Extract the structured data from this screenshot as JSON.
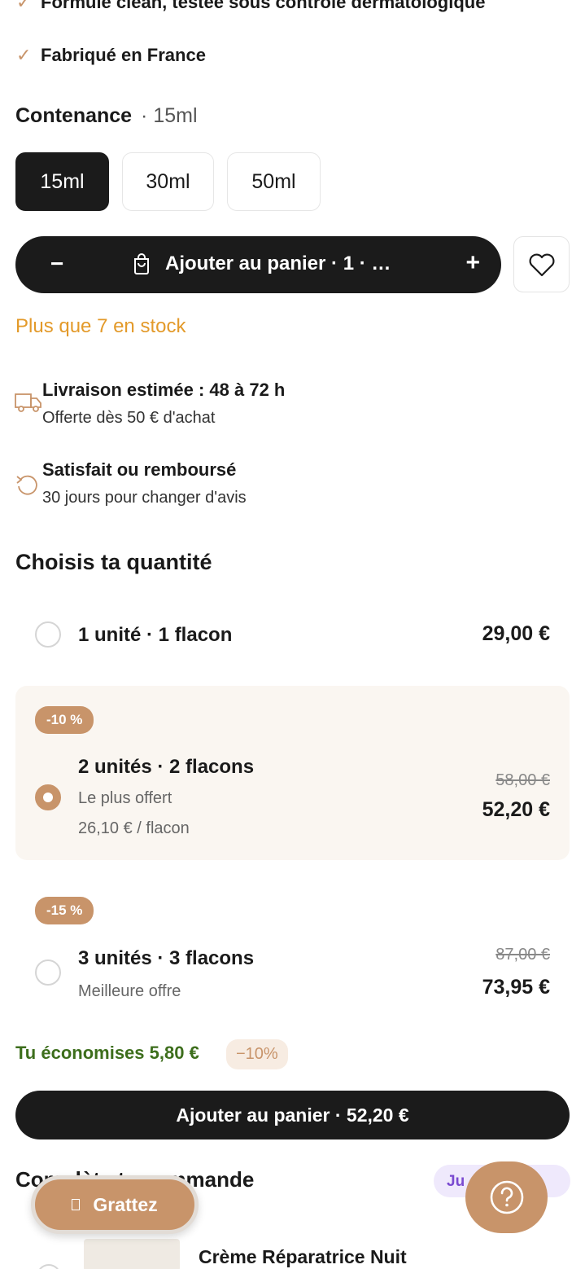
{
  "features": [
    "Formule clean, testée sous contrôle dermatologique",
    "Fabriqué en France"
  ],
  "contenance": {
    "label": "Contenance",
    "selected_value": "· 15ml",
    "sizes": [
      "15ml",
      "30ml",
      "50ml"
    ]
  },
  "cart_pill": {
    "minus": "−",
    "label": "Ajouter au panier · 1 · …",
    "plus": "+"
  },
  "stock_text": "Plus que 7 en stock",
  "delivery": {
    "title": "Livraison estimée : 48 à 72 h",
    "subtitle": "Offerte dès 50 € d'achat"
  },
  "refund": {
    "title": "Satisfait ou remboursé",
    "subtitle": "30 jours pour changer d'avis"
  },
  "quantity": {
    "title": "Choisis ta quantité",
    "options": [
      {
        "title": "1 unité · 1 flacon",
        "price": "29,00 €",
        "selected": false
      },
      {
        "badge": "-10 %",
        "title": "2 unités · 2 flacons",
        "subtitle": "Le plus offert",
        "unit_price": "26,10 € / flacon",
        "old_price": "58,00 €",
        "price": "52,20 €",
        "selected": true
      },
      {
        "badge": "-15 %",
        "title": "3 unités · 3 flacons",
        "subtitle": "Meilleure offre",
        "old_price": "87,00 €",
        "price": "73,95 €",
        "selected": false
      }
    ]
  },
  "savings": {
    "text": "Tu économises 5,80 €",
    "badge": "−10%"
  },
  "cta_label": "Ajouter au panier  · 52,20 €",
  "complete": {
    "title": "Complète ta commande",
    "badge": "Ju"
  },
  "scratch_label": "Grattez",
  "product_name": "Crème Réparatrice Nuit",
  "colors": {
    "accent": "#c8946a",
    "dark": "#1b1b1b",
    "stock": "#e39a2a",
    "savings": "#3d6e1c"
  }
}
